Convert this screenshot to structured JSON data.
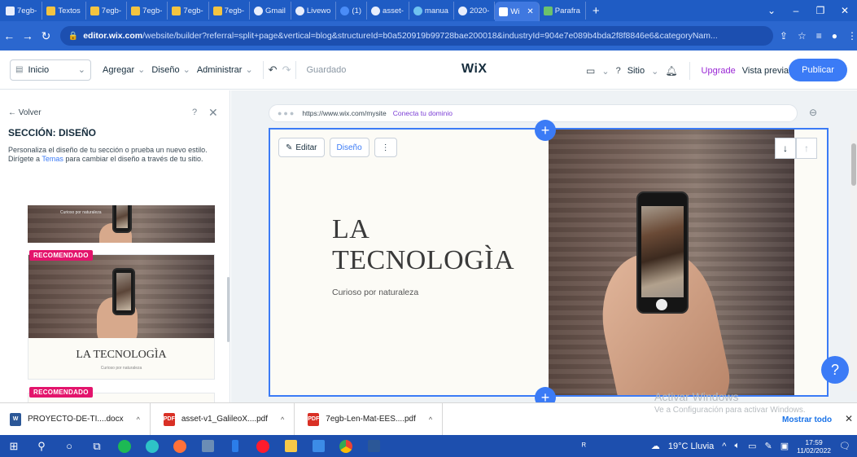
{
  "browser": {
    "tabs": [
      {
        "label": "7egb-"
      },
      {
        "label": "Textos"
      },
      {
        "label": "7egb-"
      },
      {
        "label": "7egb-"
      },
      {
        "label": "7egb-"
      },
      {
        "label": "7egb-"
      },
      {
        "label": "Gmail"
      },
      {
        "label": "Livewo"
      },
      {
        "label": "(1)"
      },
      {
        "label": "asset-"
      },
      {
        "label": "manua"
      },
      {
        "label": "2020-"
      },
      {
        "label": "Wi"
      },
      {
        "label": "Parafra"
      }
    ],
    "active_tab_index": 12,
    "url_host": "editor.wix.com",
    "url_path": "/website/builder?referral=split+page&vertical=blog&structureId=b0a520919b99728bae200018&industryId=904e7e089b4bda2f8f8846e6&categoryNam..."
  },
  "wix": {
    "page_select": "Inicio",
    "menu": [
      "Agregar",
      "Diseño",
      "Administrar"
    ],
    "saved_status": "Guardado",
    "logo": "WiX",
    "site_menu": "Sitio",
    "upgrade": "Upgrade",
    "preview": "Vista previa",
    "publish": "Publicar"
  },
  "panel": {
    "back": "← Volver",
    "help": "?",
    "title": "SECCIÓN: DISEÑO",
    "desc1": "Personaliza el diseño de tu sección o prueba un nuevo estilo.",
    "desc2_pre": "Dirígete a ",
    "desc2_link": "Temas",
    "desc2_post": " para cambiar el diseño a través de tu sitio.",
    "thumb1_caption": "Curioso por naturaleza",
    "badge": "RECOMENDADO",
    "thumb2_title": "LA TECNOLOGÌA",
    "thumb2_sub": "Curioso por naturaleza"
  },
  "canvas": {
    "site_url": "https://www.wix.com/mysite",
    "connect_domain": "Conecta tu dominio",
    "edit_btn": "Editar",
    "design_btn": "Diseño",
    "hero_line1": "LA",
    "hero_line2": "TECNOLOGÌA",
    "hero_sub": "Curioso por naturaleza"
  },
  "system": {
    "watermark1": "Activar Windows",
    "watermark2": "Ve a Configuración para activar Windows.",
    "downloads": [
      {
        "name": "PROYECTO-DE-TI....docx",
        "type": "docx"
      },
      {
        "name": "asset-v1_GalileoX....pdf",
        "type": "pdf"
      },
      {
        "name": "7egb-Len-Mat-EES....pdf",
        "type": "pdf"
      }
    ],
    "show_all": "Mostrar todo",
    "weather": "19°C Lluvia",
    "time": "17:59",
    "date": "11/02/2022"
  },
  "colors": {
    "chrome_blue": "#1f5cc4",
    "wix_blue": "#3b7bf6",
    "upgrade_purple": "#9a27d5",
    "badge_pink": "#e3146c"
  }
}
